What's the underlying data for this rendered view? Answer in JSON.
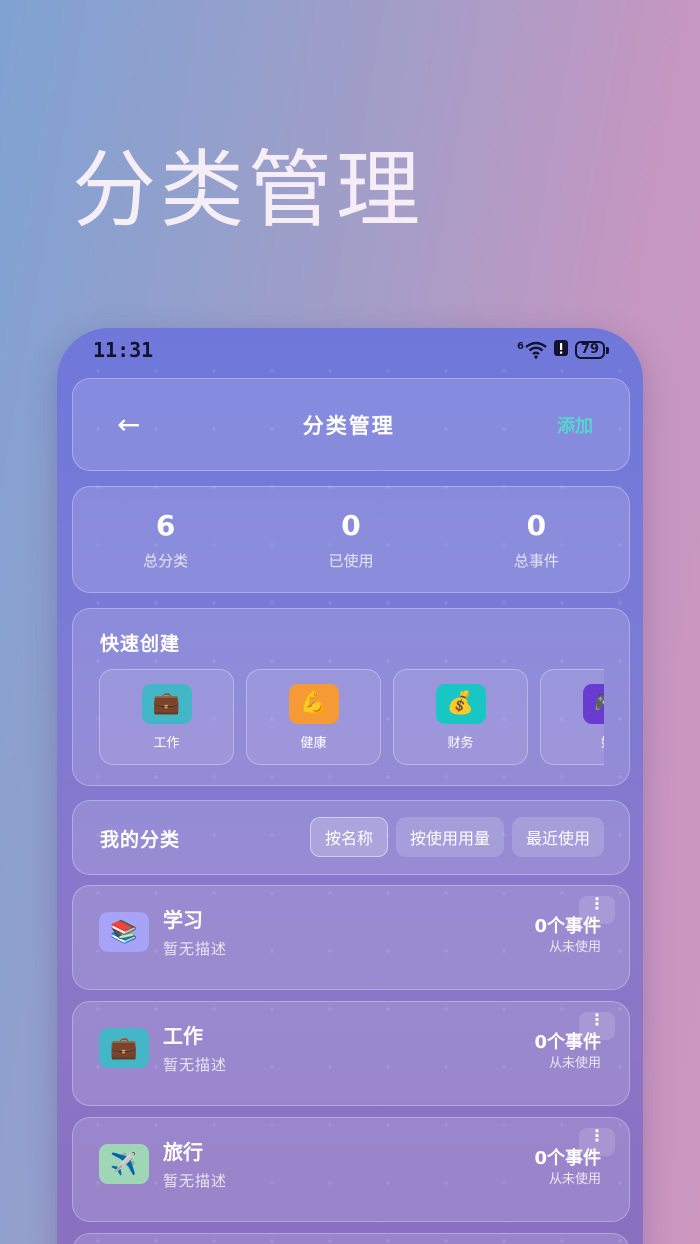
{
  "hero": {
    "title": "分类管理"
  },
  "status_bar": {
    "time": "11:31",
    "signal": "6",
    "battery": "79"
  },
  "header": {
    "back_icon": "←",
    "title": "分类管理",
    "add_label": "添加"
  },
  "stats": [
    {
      "value": "6",
      "label": "总分类"
    },
    {
      "value": "0",
      "label": "已使用"
    },
    {
      "value": "0",
      "label": "总事件"
    }
  ],
  "quick_create": {
    "title": "快速创建",
    "items": [
      {
        "icon": "💼",
        "icon_name": "briefcase-icon",
        "label": "工作",
        "color": "#43b6c8"
      },
      {
        "icon": "💪",
        "icon_name": "flexed-biceps-icon",
        "label": "健康",
        "color": "#f59a35"
      },
      {
        "icon": "💰",
        "icon_name": "money-bag-icon",
        "label": "财务",
        "color": "#18c6c4"
      },
      {
        "icon": "🎮",
        "icon_name": "game-controller-icon",
        "label": "娱",
        "color": "#6a3bd1"
      }
    ]
  },
  "my_categories": {
    "title": "我的分类",
    "sort_options": [
      "按名称",
      "按使用用量",
      "最近使用"
    ],
    "active_sort": 0
  },
  "categories": [
    {
      "name": "学习",
      "desc": "暂无描述",
      "count": "0个事件",
      "last_used": "从未使用",
      "icon": "📚",
      "icon_name": "books-icon",
      "color": "#a7a3f6"
    },
    {
      "name": "工作",
      "desc": "暂无描述",
      "count": "0个事件",
      "last_used": "从未使用",
      "icon": "💼",
      "icon_name": "briefcase-icon",
      "color": "#43b6c8"
    },
    {
      "name": "旅行",
      "desc": "暂无描述",
      "count": "0个事件",
      "last_used": "从未使用",
      "icon": "✈️",
      "icon_name": "airplane-icon",
      "color": "#9fd7b6"
    }
  ],
  "more_icon": "⋮"
}
